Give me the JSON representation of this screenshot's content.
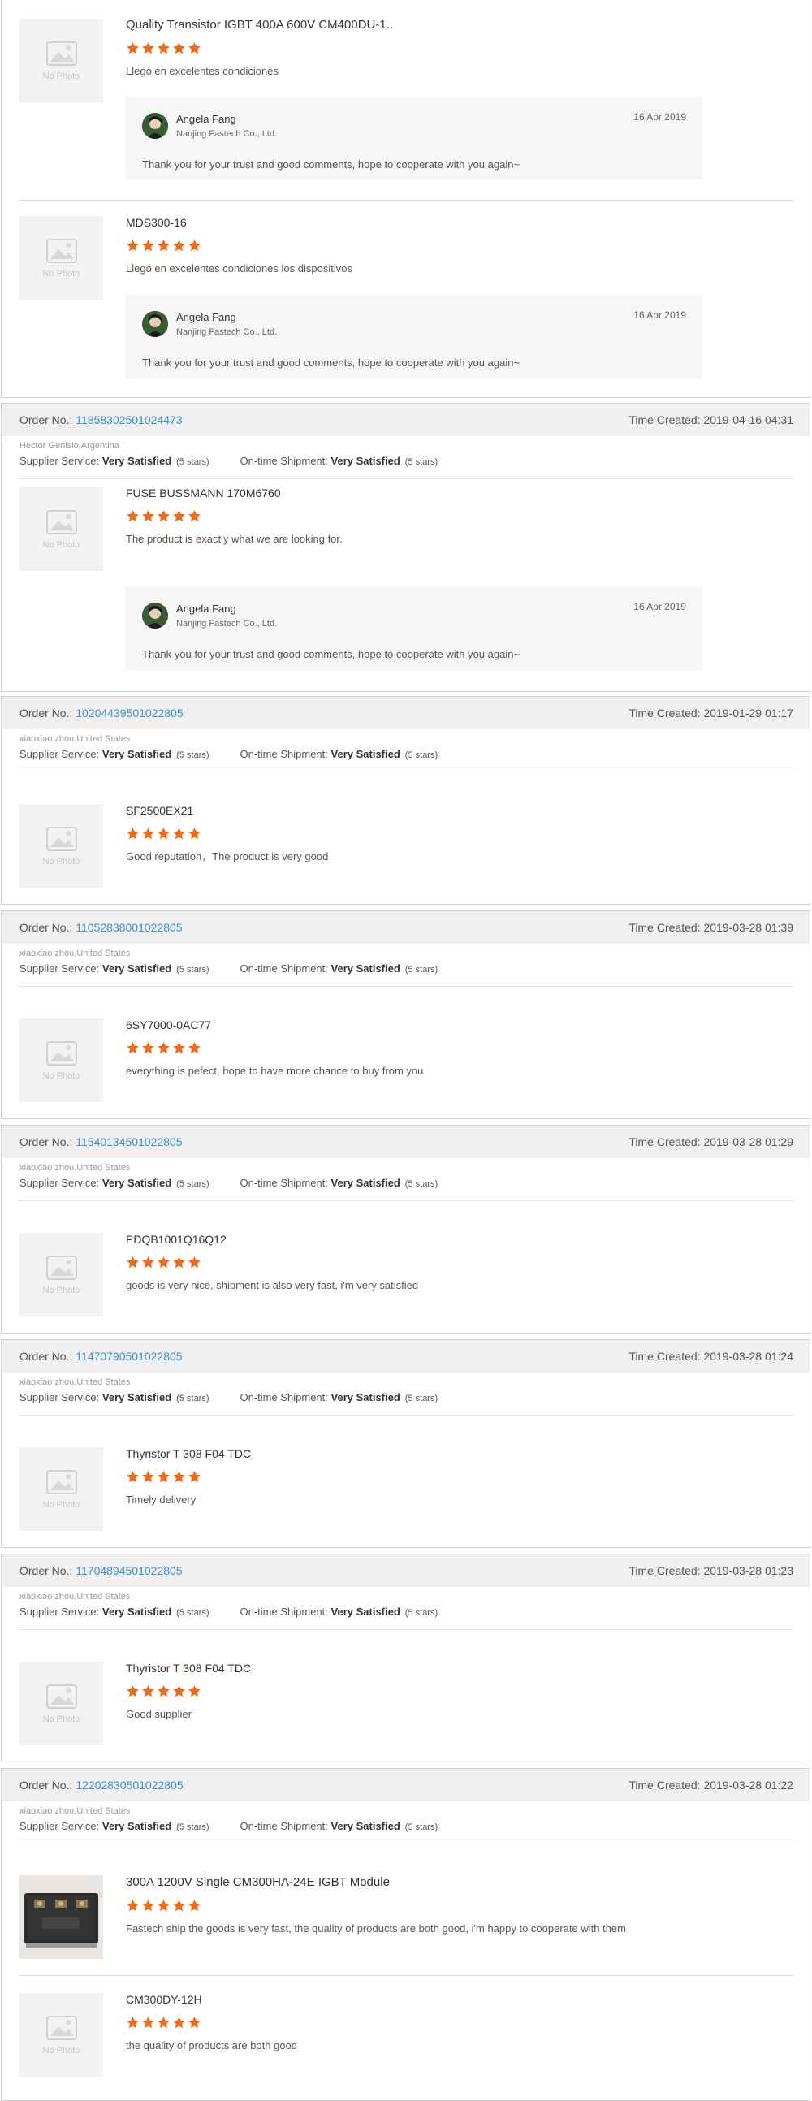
{
  "labels": {
    "order_no": "Order No.: ",
    "time_created": "Time Created: ",
    "supplier_service": "Supplier Service: ",
    "shipment": "On-time Shipment: ",
    "very_satisfied": "Very Satisfied",
    "five_stars": "(5 stars)",
    "no_photo": "No Photo"
  },
  "reply": {
    "name": "Angela Fang",
    "company": "Nanjing Fastech Co., Ltd.",
    "text": "Thank you for your trust and good comments, hope to cooperate with you again~"
  },
  "colors": {
    "accent": "#3a8fd0",
    "star": "#ee6a1d",
    "header_bg": "#f0f0f0"
  },
  "card0": {
    "items": [
      {
        "title": "Quality Transistor IGBT 400A 600V CM400DU-1..",
        "rating": 5,
        "comment": "Llegó en excelentes condiciones",
        "reply_date": "16 Apr 2019"
      },
      {
        "title": "MDS300-16",
        "rating": 5,
        "comment": "Llegó en excelentes condiciones los dispositivos",
        "reply_date": "16 Apr 2019"
      }
    ]
  },
  "orders": [
    {
      "order_no": "11858302501024473",
      "time": "2019-04-16 04:31",
      "buyer": "Hector Genisio,Argentina",
      "items": [
        {
          "title": "FUSE BUSSMANN 170M6760",
          "rating": 5,
          "comment": "The product is exactly what we are looking for.",
          "reply_date": "16 Apr 2019"
        }
      ]
    },
    {
      "order_no": "10204439501022805",
      "time": "2019-01-29 01:17",
      "buyer": "xiaoxiao zhou,United States",
      "items": [
        {
          "title": "SF2500EX21",
          "rating": 5,
          "comment": "Good reputation，The product is very good"
        }
      ]
    },
    {
      "order_no": "11052838001022805",
      "time": "2019-03-28 01:39",
      "buyer": "xiaoxiao zhou,United States",
      "items": [
        {
          "title": "6SY7000-0AC77",
          "rating": 5,
          "comment": "everything is pefect, hope to have more chance to buy from you"
        }
      ]
    },
    {
      "order_no": "11540134501022805",
      "time": "2019-03-28 01:29",
      "buyer": "xiaoxiao zhou,United States",
      "items": [
        {
          "title": "PDQB1001Q16Q12",
          "rating": 5,
          "comment": "goods is very nice, shipment is also very fast, i'm very satisfied"
        }
      ]
    },
    {
      "order_no": "11470790501022805",
      "time": "2019-03-28 01:24",
      "buyer": "xiaoxiao zhou,United States",
      "items": [
        {
          "title": "Thyristor T 308 F04 TDC",
          "rating": 5,
          "comment": "Timely delivery"
        }
      ]
    },
    {
      "order_no": "11704894501022805",
      "time": "2019-03-28 01:23",
      "buyer": "xiaoxiao zhou,United States",
      "items": [
        {
          "title": "Thyristor T 308 F04 TDC",
          "rating": 5,
          "comment": "Good supplier"
        }
      ]
    },
    {
      "order_no": "12202830501022805",
      "time": "2019-03-28 01:22",
      "buyer": "xiaoxiao zhou,United States",
      "items": [
        {
          "title": "300A 1200V Single CM300HA-24E IGBT Module",
          "rating": 5,
          "comment": "Fastech ship the goods is very fast, the quality of products are both good, i'm happy to cooperate with them"
        },
        {
          "title": "CM300DY-12H",
          "rating": 5,
          "comment": "the quality of products are both good"
        }
      ]
    }
  ]
}
